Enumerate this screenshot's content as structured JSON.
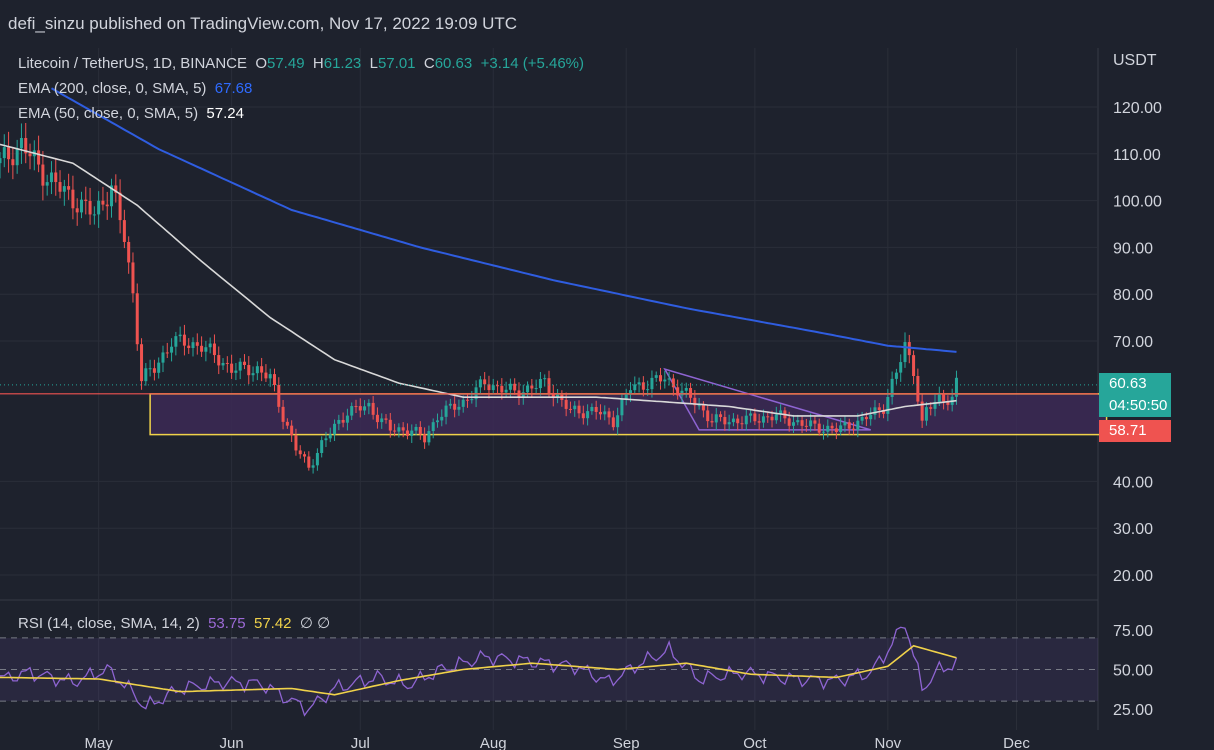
{
  "header": {
    "author": "defi_sinzu",
    "published_text": "published on TradingView.com, Nov 17, 2022 19:09 UTC"
  },
  "legend": {
    "symbol": "Litecoin / TetherUS, 1D, BINANCE",
    "o_label": "O",
    "o": "57.49",
    "h_label": "H",
    "h": "61.23",
    "l_label": "L",
    "l": "57.01",
    "c_label": "C",
    "c": "60.63",
    "change": "+3.14 (+5.46%)",
    "ema200_label": "EMA (200, close, 0, SMA, 5)",
    "ema200_value": "67.68",
    "ema50_label": "EMA (50, close, 0, SMA, 5)",
    "ema50_value": "57.24",
    "rsi_label": "RSI (14, close, SMA, 14, 2)",
    "rsi_value": "53.75",
    "rsi_sma_value": "57.42",
    "rsi_extra": "∅ ∅"
  },
  "axis": {
    "currency": "USDT",
    "price_ticks": [
      "120.00",
      "110.00",
      "100.00",
      "90.00",
      "80.00",
      "70.00",
      "40.00",
      "30.00",
      "20.00"
    ],
    "rsi_ticks": [
      "75.00",
      "50.00",
      "25.00"
    ],
    "month_ticks": [
      "May",
      "Jun",
      "Jul",
      "Aug",
      "Sep",
      "Oct",
      "Nov",
      "Dec"
    ]
  },
  "price_tags": {
    "last": "60.63",
    "countdown": "04:50:50",
    "line_price": "58.71"
  },
  "colors": {
    "up": "#26a69a",
    "down": "#ef5350",
    "ema200": "#2f5de0",
    "ema50": "#d9d9d9",
    "zone_border": "#f0d24a",
    "zone_fill": "#3d2a57",
    "rsi": "#8e64d2",
    "rsi_sma": "#f0d24a"
  },
  "chart_data": {
    "type": "candlestick",
    "title": "Litecoin / TetherUS, 1D, BINANCE",
    "ylabel": "USDT",
    "ylim": [
      15,
      125
    ],
    "x_start": "2022-04-08",
    "x_end": "2022-12-20",
    "month_ticks": [
      {
        "label": "May",
        "date": "2022-05-01"
      },
      {
        "label": "Jun",
        "date": "2022-06-01"
      },
      {
        "label": "Jul",
        "date": "2022-07-01"
      },
      {
        "label": "Aug",
        "date": "2022-08-01"
      },
      {
        "label": "Sep",
        "date": "2022-09-01"
      },
      {
        "label": "Oct",
        "date": "2022-10-01"
      },
      {
        "label": "Nov",
        "date": "2022-11-01"
      },
      {
        "label": "Dec",
        "date": "2022-12-01"
      }
    ],
    "close_anchors": [
      [
        "2022-04-08",
        108
      ],
      [
        "2022-04-13",
        112
      ],
      [
        "2022-04-18",
        106
      ],
      [
        "2022-04-24",
        101
      ],
      [
        "2022-04-30",
        97
      ],
      [
        "2022-05-04",
        103
      ],
      [
        "2022-05-07",
        92
      ],
      [
        "2022-05-09",
        80
      ],
      [
        "2022-05-11",
        62
      ],
      [
        "2022-05-14",
        64
      ],
      [
        "2022-05-18",
        70
      ],
      [
        "2022-05-25",
        69
      ],
      [
        "2022-06-01",
        64
      ],
      [
        "2022-06-07",
        64
      ],
      [
        "2022-06-10",
        62
      ],
      [
        "2022-06-13",
        54
      ],
      [
        "2022-06-16",
        47
      ],
      [
        "2022-06-19",
        43
      ],
      [
        "2022-06-22",
        48
      ],
      [
        "2022-06-28",
        55
      ],
      [
        "2022-07-03",
        56
      ],
      [
        "2022-07-08",
        51
      ],
      [
        "2022-07-13",
        51
      ],
      [
        "2022-07-16",
        49
      ],
      [
        "2022-07-19",
        54
      ],
      [
        "2022-07-25",
        57
      ],
      [
        "2022-07-30",
        61
      ],
      [
        "2022-08-06",
        59
      ],
      [
        "2022-08-13",
        61
      ],
      [
        "2022-08-19",
        55
      ],
      [
        "2022-08-25",
        55
      ],
      [
        "2022-08-29",
        53
      ],
      [
        "2022-09-02",
        60
      ],
      [
        "2022-09-10",
        62
      ],
      [
        "2022-09-17",
        57
      ],
      [
        "2022-09-21",
        53
      ],
      [
        "2022-09-28",
        53
      ],
      [
        "2022-10-06",
        54
      ],
      [
        "2022-10-13",
        52
      ],
      [
        "2022-10-20",
        51
      ],
      [
        "2022-10-26",
        53
      ],
      [
        "2022-10-31",
        56
      ],
      [
        "2022-11-03",
        63
      ],
      [
        "2022-11-05",
        69
      ],
      [
        "2022-11-07",
        64
      ],
      [
        "2022-11-09",
        52
      ],
      [
        "2022-11-10",
        55
      ],
      [
        "2022-11-13",
        58
      ],
      [
        "2022-11-16",
        57.5
      ],
      [
        "2022-11-17",
        60.63
      ]
    ],
    "ema200_anchors": [
      [
        "2022-04-20",
        124
      ],
      [
        "2022-05-15",
        111
      ],
      [
        "2022-06-15",
        98
      ],
      [
        "2022-07-15",
        90
      ],
      [
        "2022-08-15",
        83
      ],
      [
        "2022-09-15",
        77
      ],
      [
        "2022-10-15",
        72
      ],
      [
        "2022-11-01",
        69
      ],
      [
        "2022-11-17",
        67.68
      ]
    ],
    "ema50_anchors": [
      [
        "2022-04-08",
        112
      ],
      [
        "2022-04-25",
        108
      ],
      [
        "2022-05-10",
        99
      ],
      [
        "2022-05-25",
        87
      ],
      [
        "2022-06-10",
        75
      ],
      [
        "2022-06-25",
        66
      ],
      [
        "2022-07-10",
        61
      ],
      [
        "2022-07-25",
        58
      ],
      [
        "2022-08-10",
        58
      ],
      [
        "2022-08-25",
        58
      ],
      [
        "2022-09-10",
        57
      ],
      [
        "2022-09-25",
        56
      ],
      [
        "2022-10-10",
        54
      ],
      [
        "2022-10-25",
        54
      ],
      [
        "2022-11-05",
        56
      ],
      [
        "2022-11-17",
        57.24
      ]
    ],
    "support_zone": {
      "from": "2022-05-13",
      "to": "2022-12-22",
      "low": 50,
      "high": 58.7
    },
    "horizontal_line": 58.71,
    "last_price": 60.63,
    "triangle": [
      [
        "2022-09-10",
        64
      ],
      [
        "2022-10-28",
        51
      ],
      [
        "2022-09-18",
        51
      ]
    ],
    "rsi": {
      "ylim": [
        20,
        80
      ],
      "levels": [
        70,
        50,
        30
      ],
      "anchors": [
        [
          "2022-04-08",
          44
        ],
        [
          "2022-04-15",
          48
        ],
        [
          "2022-04-25",
          42
        ],
        [
          "2022-05-03",
          50
        ],
        [
          "2022-05-08",
          38
        ],
        [
          "2022-05-12",
          26
        ],
        [
          "2022-05-20",
          38
        ],
        [
          "2022-05-30",
          42
        ],
        [
          "2022-06-08",
          41
        ],
        [
          "2022-06-15",
          30
        ],
        [
          "2022-06-19",
          25
        ],
        [
          "2022-06-25",
          38
        ],
        [
          "2022-07-05",
          45
        ],
        [
          "2022-07-12",
          40
        ],
        [
          "2022-07-20",
          50
        ],
        [
          "2022-07-30",
          58
        ],
        [
          "2022-08-10",
          55
        ],
        [
          "2022-08-20",
          52
        ],
        [
          "2022-08-28",
          42
        ],
        [
          "2022-09-05",
          55
        ],
        [
          "2022-09-11",
          62
        ],
        [
          "2022-09-18",
          44
        ],
        [
          "2022-09-28",
          48
        ],
        [
          "2022-10-10",
          44
        ],
        [
          "2022-10-20",
          43
        ],
        [
          "2022-10-28",
          48
        ],
        [
          "2022-11-01",
          62
        ],
        [
          "2022-11-05",
          80
        ],
        [
          "2022-11-09",
          38
        ],
        [
          "2022-11-13",
          50
        ],
        [
          "2022-11-17",
          53.75
        ]
      ],
      "sma_anchors": [
        [
          "2022-04-08",
          45
        ],
        [
          "2022-05-01",
          44
        ],
        [
          "2022-05-20",
          36
        ],
        [
          "2022-06-15",
          38
        ],
        [
          "2022-06-25",
          34
        ],
        [
          "2022-07-10",
          43
        ],
        [
          "2022-07-25",
          50
        ],
        [
          "2022-08-10",
          54
        ],
        [
          "2022-08-30",
          50
        ],
        [
          "2022-09-15",
          54
        ],
        [
          "2022-09-30",
          47
        ],
        [
          "2022-10-20",
          45
        ],
        [
          "2022-11-01",
          52
        ],
        [
          "2022-11-07",
          65
        ],
        [
          "2022-11-17",
          57.42
        ]
      ]
    }
  }
}
